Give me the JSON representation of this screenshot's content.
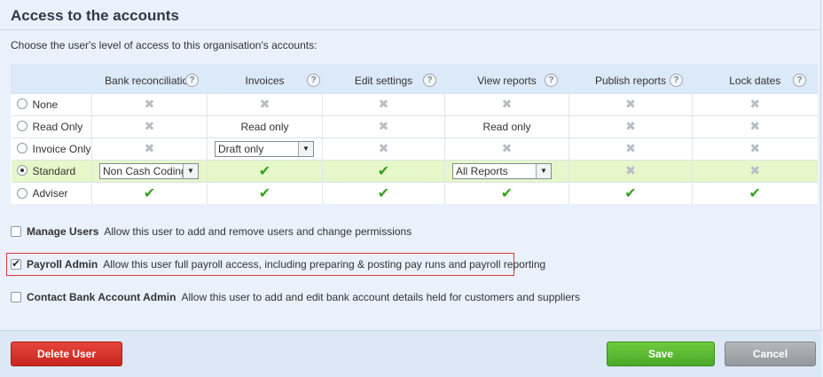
{
  "header": {
    "title": "Access to the accounts",
    "subtitle": "Choose the user's level of access to this organisation's accounts:"
  },
  "table": {
    "columns": [
      "Bank reconciliation",
      "Invoices",
      "Edit settings",
      "View reports",
      "Publish reports",
      "Lock dates"
    ],
    "help_glyph": "?",
    "x_glyph": "✖",
    "tick_glyph": "✔",
    "arrow_glyph": "▼",
    "rows": [
      {
        "label": "None",
        "selected": false
      },
      {
        "label": "Read Only",
        "selected": false,
        "invoices_text": "Read only",
        "view_reports_text": "Read only"
      },
      {
        "label": "Invoice Only",
        "selected": false,
        "invoices_select": "Draft only"
      },
      {
        "label": "Standard",
        "selected": true,
        "bank_select": "Non Cash Coding",
        "view_reports_select": "All Reports"
      },
      {
        "label": "Adviser",
        "selected": false
      }
    ]
  },
  "permissions": {
    "manage_users": {
      "label": "Manage Users",
      "desc": "Allow this user to add and remove users and change permissions",
      "checked": false
    },
    "payroll_admin": {
      "label": "Payroll Admin",
      "desc": "Allow this user full payroll access, including preparing & posting pay runs and payroll reporting",
      "checked": true
    },
    "contact_bank": {
      "label": "Contact Bank Account Admin",
      "desc": "Allow this user to add and edit bank account details held for customers and suppliers",
      "checked": false
    }
  },
  "footer": {
    "delete_label": "Delete User",
    "save_label": "Save",
    "cancel_label": "Cancel"
  },
  "colors": {
    "accent_green": "#4aa828",
    "danger_red": "#c8261e",
    "selected_row": "#e6f7c9",
    "highlight_border": "#d73a3a"
  }
}
